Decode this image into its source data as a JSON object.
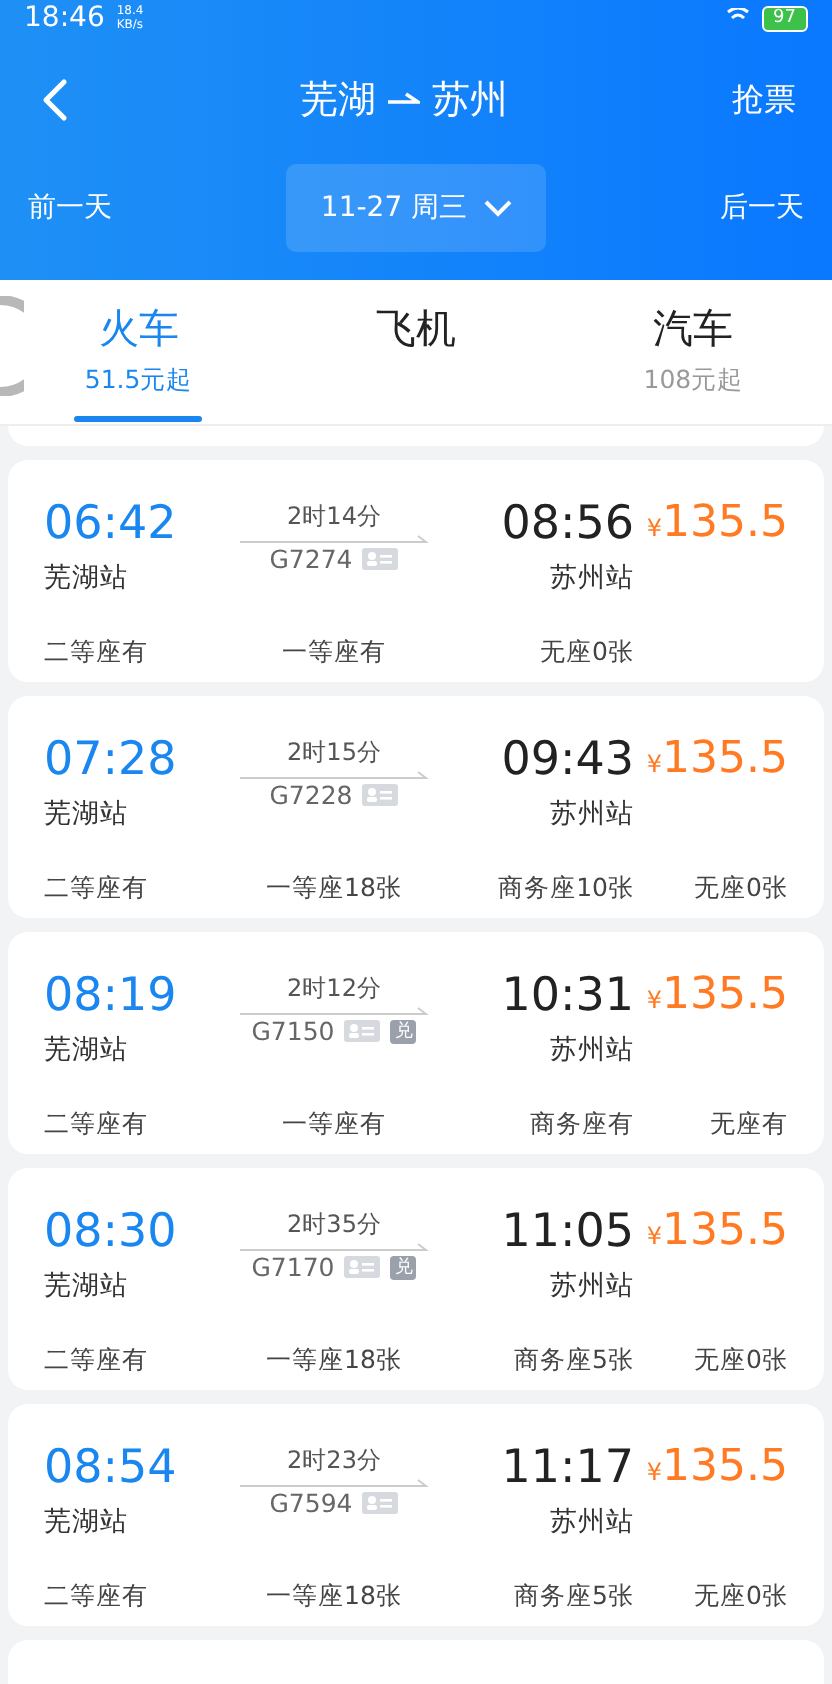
{
  "status_bar": {
    "time": "18:46",
    "speed": "18.4",
    "speed_unit": "KB/s",
    "battery": "97"
  },
  "nav": {
    "title_from": "芜湖",
    "title_to": "苏州",
    "action": "抢票"
  },
  "date_bar": {
    "prev": "前一天",
    "date": "11-27 周三",
    "next": "后一天"
  },
  "tabs": [
    {
      "label": "火车",
      "sub": "51.5元起",
      "selected": true
    },
    {
      "label": "飞机",
      "selected": false
    },
    {
      "label": "汽车",
      "sub": "108元起",
      "selected": false
    }
  ],
  "trains": [
    {
      "depart": "06:42",
      "from": "芜湖站",
      "duration": "2时14分",
      "number": "G7274",
      "tags": [
        {
          "kind": "id"
        }
      ],
      "arrive": "08:56",
      "to": "苏州站",
      "currency": "¥",
      "price": "135.5",
      "seats": [
        "二等座有",
        "一等座有",
        "无座0张"
      ]
    },
    {
      "depart": "07:28",
      "from": "芜湖站",
      "duration": "2时15分",
      "number": "G7228",
      "tags": [
        {
          "kind": "id"
        }
      ],
      "arrive": "09:43",
      "to": "苏州站",
      "currency": "¥",
      "price": "135.5",
      "seats": [
        "二等座有",
        "一等座18张",
        "商务座10张",
        "无座0张"
      ]
    },
    {
      "depart": "08:19",
      "from": "芜湖站",
      "duration": "2时12分",
      "number": "G7150",
      "tags": [
        {
          "kind": "id"
        },
        {
          "kind": "text",
          "text": "兑"
        }
      ],
      "arrive": "10:31",
      "to": "苏州站",
      "currency": "¥",
      "price": "135.5",
      "seats": [
        "二等座有",
        "一等座有",
        "商务座有",
        "无座有"
      ]
    },
    {
      "depart": "08:30",
      "from": "芜湖站",
      "duration": "2时35分",
      "number": "G7170",
      "tags": [
        {
          "kind": "id"
        },
        {
          "kind": "text",
          "text": "兑"
        }
      ],
      "arrive": "11:05",
      "to": "苏州站",
      "currency": "¥",
      "price": "135.5",
      "seats": [
        "二等座有",
        "一等座18张",
        "商务座5张",
        "无座0张"
      ]
    },
    {
      "depart": "08:54",
      "from": "芜湖站",
      "duration": "2时23分",
      "number": "G7594",
      "tags": [
        {
          "kind": "id"
        }
      ],
      "arrive": "11:17",
      "to": "苏州站",
      "currency": "¥",
      "price": "135.5",
      "seats": [
        "二等座有",
        "一等座18张",
        "商务座5张",
        "无座0张"
      ]
    }
  ]
}
